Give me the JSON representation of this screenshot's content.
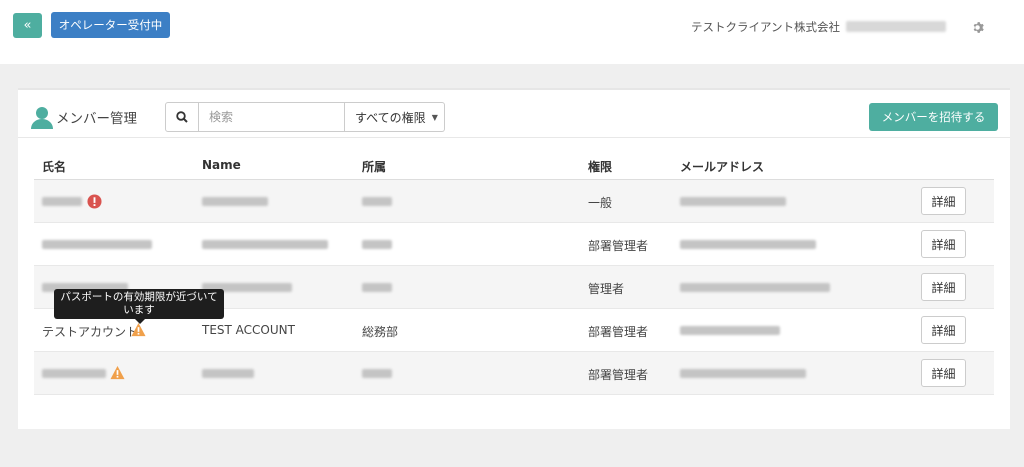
{
  "colors": {
    "accent_teal": "#4eaea0",
    "operator_blue": "#3c7fc5",
    "error_red": "#d9534f",
    "warning_orange": "#f0a04b"
  },
  "header": {
    "collapse_label": "«",
    "operator_status": "オペレーター受付中",
    "company": "テストクライアント株式会社",
    "settings_icon": "gear-icon"
  },
  "panel": {
    "title": "メンバー管理",
    "search": {
      "placeholder": "検索",
      "value": ""
    },
    "permission_filter": "すべての権限",
    "invite_button": "メンバーを招待する"
  },
  "table": {
    "columns": [
      "氏名",
      "Name",
      "所属",
      "権限",
      "メールアドレス"
    ],
    "detail_label": "詳細",
    "rows": [
      {
        "name": "",
        "name_en": "",
        "dept": "",
        "role": "一般",
        "email": "",
        "status_icon": "error-icon"
      },
      {
        "name": "",
        "name_en": "",
        "dept": "",
        "role": "部署管理者",
        "email": "",
        "status_icon": ""
      },
      {
        "name": "",
        "name_en": "",
        "dept": "",
        "role": "管理者",
        "email": "",
        "status_icon": ""
      },
      {
        "name": "テストアカウント",
        "name_en": "TEST ACCOUNT",
        "dept": "総務部",
        "role": "部署管理者",
        "email": "",
        "status_icon": "warning-icon"
      },
      {
        "name": "",
        "name_en": "",
        "dept": "",
        "role": "部署管理者",
        "email": "",
        "status_icon": "warning-icon"
      }
    ]
  },
  "tooltip": {
    "line1": "パスポートの有効期限が近づいて",
    "line2": "います"
  }
}
